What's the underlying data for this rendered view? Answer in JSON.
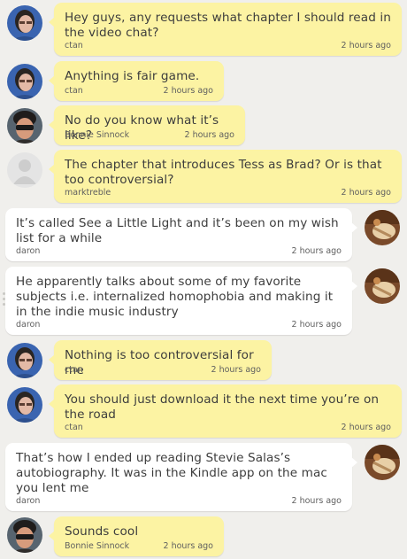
{
  "messages": [
    {
      "side": "left",
      "avatar": "avatar-ctan",
      "text": "Hey guys, any requests what chapter I should read in the video chat?",
      "author": "ctan",
      "time": "2 hours ago"
    },
    {
      "side": "left",
      "avatar": "avatar-ctan",
      "text": "Anything is fair game.",
      "author": "ctan",
      "time": "2 hours ago"
    },
    {
      "side": "left",
      "avatar": "avatar-bonnie",
      "text": "No do you know what it’s like?",
      "author": "Bonnie Sinnock",
      "time": "2 hours ago"
    },
    {
      "side": "left",
      "avatar": "avatar-default",
      "text": "The chapter that introduces Tess as Brad? Or is that too controversial?",
      "author": "marktreble",
      "time": "2 hours ago"
    },
    {
      "side": "right",
      "avatar": "avatar-daron",
      "text": "It’s called See a Little Light and it’s been on my wish list for a while",
      "author": "daron",
      "time": "2 hours ago"
    },
    {
      "side": "right",
      "avatar": "avatar-daron",
      "text": "He apparently talks about some of my favorite subjects i.e. internalized homophobia and making it in the indie music industry",
      "author": "daron",
      "time": "2 hours ago"
    },
    {
      "side": "left",
      "avatar": "avatar-ctan",
      "text": "Nothing is too controversial for me",
      "author": "ctan",
      "time": "2 hours ago"
    },
    {
      "side": "left",
      "avatar": "avatar-ctan",
      "text": "You should just download it the next time you’re on the road",
      "author": "ctan",
      "time": "2 hours ago"
    },
    {
      "side": "right",
      "avatar": "avatar-daron",
      "text": "That’s how I ended up reading Stevie Salas’s autobiography. It was in the Kindle app on the mac you lent me",
      "author": "daron",
      "time": "2 hours ago"
    },
    {
      "side": "left",
      "avatar": "avatar-bonnie",
      "text": "Sounds cool",
      "author": "Bonnie Sinnock",
      "time": "2 hours ago"
    }
  ],
  "colors": {
    "background": "#f0efec",
    "bubble_own": "#fcf3a3",
    "bubble_other": "#ffffff"
  }
}
